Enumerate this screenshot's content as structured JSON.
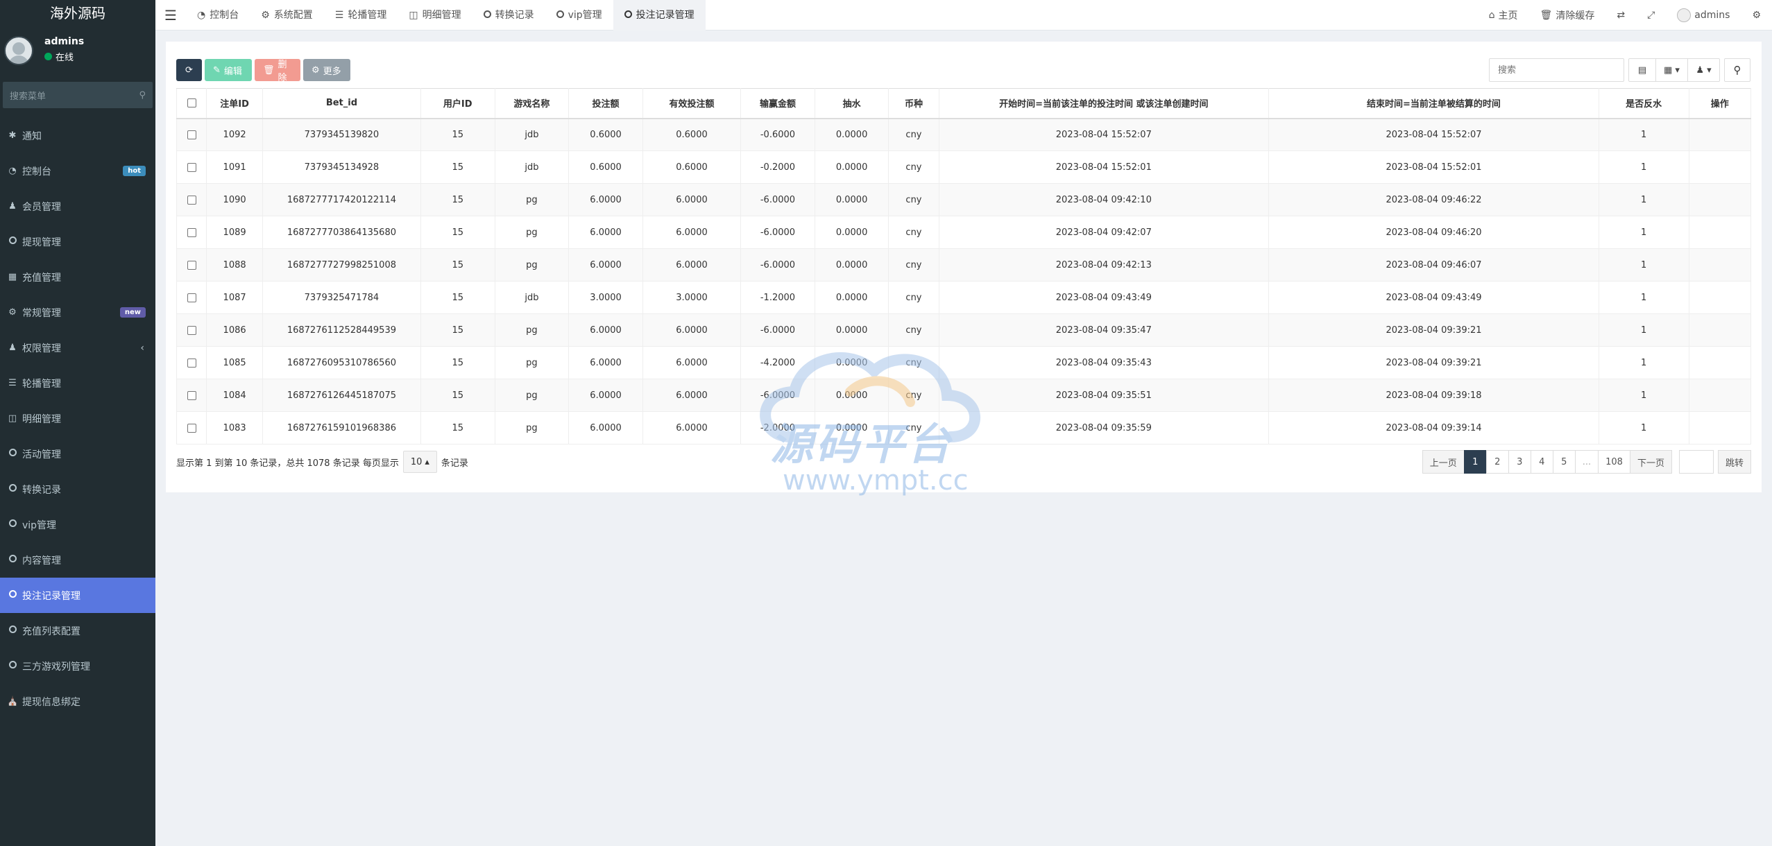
{
  "app": {
    "title": "海外源码"
  },
  "user": {
    "name": "admins",
    "status": "在线"
  },
  "sidebar": {
    "search_placeholder": "搜索菜单",
    "items": [
      {
        "label": "通知",
        "icon": "asterisk-icon"
      },
      {
        "label": "控制台",
        "icon": "dashboard-icon",
        "badge": "hot"
      },
      {
        "label": "会员管理",
        "icon": "users-icon"
      },
      {
        "label": "提现管理",
        "icon": "circle-icon"
      },
      {
        "label": "充值管理",
        "icon": "grid-icon"
      },
      {
        "label": "常规管理",
        "icon": "cogs-icon",
        "badge": "new"
      },
      {
        "label": "权限管理",
        "icon": "users-icon"
      },
      {
        "label": "轮播管理",
        "icon": "list-icon"
      },
      {
        "label": "明细管理",
        "icon": "calendar-icon"
      },
      {
        "label": "活动管理",
        "icon": "circle-icon"
      },
      {
        "label": "转换记录",
        "icon": "circle-icon"
      },
      {
        "label": "vip管理",
        "icon": "circle-icon"
      },
      {
        "label": "内容管理",
        "icon": "circle-icon"
      },
      {
        "label": "投注记录管理",
        "icon": "circle-icon",
        "active": true
      },
      {
        "label": "充值列表配置",
        "icon": "circle-icon"
      },
      {
        "label": "三方游戏列管理",
        "icon": "circle-icon"
      },
      {
        "label": "提现信息绑定",
        "icon": "bank-icon"
      }
    ]
  },
  "topnav": {
    "tabs": [
      {
        "label": "控制台",
        "icon": "dashboard-icon"
      },
      {
        "label": "系统配置",
        "icon": "gear-icon"
      },
      {
        "label": "轮播管理",
        "icon": "list-icon"
      },
      {
        "label": "明细管理",
        "icon": "calendar-icon"
      },
      {
        "label": "转换记录",
        "icon": "circle-icon"
      },
      {
        "label": "vip管理",
        "icon": "circle-icon"
      },
      {
        "label": "投注记录管理",
        "icon": "circle-icon",
        "active": true
      }
    ],
    "home_label": "主页",
    "clear_cache_label": "清除缓存",
    "user_label": "admins"
  },
  "toolbar": {
    "edit_label": "编辑",
    "delete_label": "删除",
    "more_label": "更多",
    "search_placeholder": "搜索"
  },
  "table": {
    "columns": [
      "注单ID",
      "Bet_id",
      "用户ID",
      "游戏名称",
      "投注额",
      "有效投注额",
      "输赢金额",
      "抽水",
      "币种",
      "开始时间=当前该注单的投注时间 或该注单创建时间",
      "结束时间=当前注单被结算的时间",
      "是否反水",
      "操作"
    ],
    "rows": [
      [
        "1092",
        "7379345139820",
        "15",
        "jdb",
        "0.6000",
        "0.6000",
        "-0.6000",
        "0.0000",
        "cny",
        "2023-08-04 15:52:07",
        "2023-08-04 15:52:07",
        "1",
        ""
      ],
      [
        "1091",
        "7379345134928",
        "15",
        "jdb",
        "0.6000",
        "0.6000",
        "-0.2000",
        "0.0000",
        "cny",
        "2023-08-04 15:52:01",
        "2023-08-04 15:52:01",
        "1",
        ""
      ],
      [
        "1090",
        "1687277717420122114",
        "15",
        "pg",
        "6.0000",
        "6.0000",
        "-6.0000",
        "0.0000",
        "cny",
        "2023-08-04 09:42:10",
        "2023-08-04 09:46:22",
        "1",
        ""
      ],
      [
        "1089",
        "1687277703864135680",
        "15",
        "pg",
        "6.0000",
        "6.0000",
        "-6.0000",
        "0.0000",
        "cny",
        "2023-08-04 09:42:07",
        "2023-08-04 09:46:20",
        "1",
        ""
      ],
      [
        "1088",
        "1687277727998251008",
        "15",
        "pg",
        "6.0000",
        "6.0000",
        "-6.0000",
        "0.0000",
        "cny",
        "2023-08-04 09:42:13",
        "2023-08-04 09:46:07",
        "1",
        ""
      ],
      [
        "1087",
        "7379325471784",
        "15",
        "jdb",
        "3.0000",
        "3.0000",
        "-1.2000",
        "0.0000",
        "cny",
        "2023-08-04 09:43:49",
        "2023-08-04 09:43:49",
        "1",
        ""
      ],
      [
        "1086",
        "1687276112528449539",
        "15",
        "pg",
        "6.0000",
        "6.0000",
        "-6.0000",
        "0.0000",
        "cny",
        "2023-08-04 09:35:47",
        "2023-08-04 09:39:21",
        "1",
        ""
      ],
      [
        "1085",
        "1687276095310786560",
        "15",
        "pg",
        "6.0000",
        "6.0000",
        "-4.2000",
        "0.0000",
        "cny",
        "2023-08-04 09:35:43",
        "2023-08-04 09:39:21",
        "1",
        ""
      ],
      [
        "1084",
        "1687276126445187075",
        "15",
        "pg",
        "6.0000",
        "6.0000",
        "-6.0000",
        "0.0000",
        "cny",
        "2023-08-04 09:35:51",
        "2023-08-04 09:39:18",
        "1",
        ""
      ],
      [
        "1083",
        "1687276159101968386",
        "15",
        "pg",
        "6.0000",
        "6.0000",
        "-2.0000",
        "0.0000",
        "cny",
        "2023-08-04 09:35:59",
        "2023-08-04 09:39:14",
        "1",
        ""
      ]
    ]
  },
  "footer": {
    "info_prefix": "显示第 1 到第 10 条记录，总共 1078 条记录 每页显示",
    "page_size": "10",
    "info_suffix": "条记录"
  },
  "pagination": {
    "prev_label": "上一页",
    "pages": [
      "1",
      "2",
      "3",
      "4",
      "5",
      "...",
      "108"
    ],
    "active_page": "1",
    "next_label": "下一页",
    "jump_label": "跳转"
  },
  "watermark": {
    "text": "源码平台",
    "url": "www.ympt.cc"
  },
  "colors": {
    "sidebar_bg": "#222d32",
    "active_menu": "#5977e0",
    "edit": "#6fd6b1",
    "delete": "#f29b91",
    "more": "#939fa8",
    "primary_dark": "#2c3e50"
  }
}
